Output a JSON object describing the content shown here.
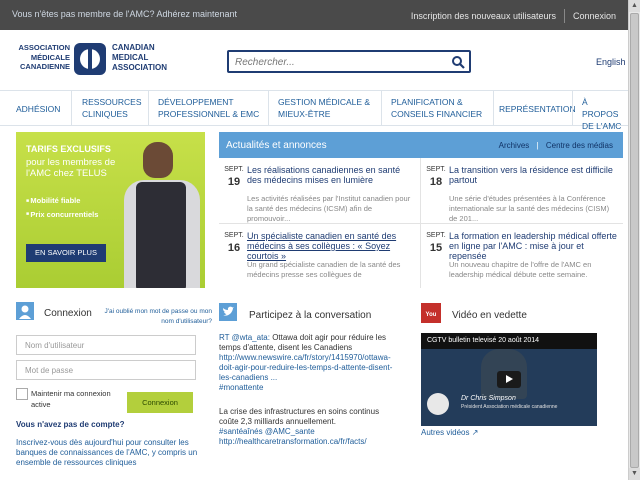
{
  "topbar": {
    "not_member": "Vous n'êtes pas membre de l'AMC? Adhérez maintenant",
    "new_users": "Inscription des nouveaux utilisateurs",
    "login": "Connexion"
  },
  "logo": {
    "fr_line1": "ASSOCIATION",
    "fr_line2": "MÉDICALE",
    "fr_line3": "CANADIENNE",
    "en_line1": "CANADIAN",
    "en_line2": "MEDICAL",
    "en_line3": "ASSOCIATION"
  },
  "search": {
    "placeholder": "Rechercher..."
  },
  "lang_switch": "English",
  "nav": [
    "ADHÉSION",
    "RESSOURCES CLINIQUES",
    "DÉVELOPPEMENT PROFESSIONNEL & EMC",
    "GESTION MÉDICALE & MIEUX-ÊTRE",
    "PLANIFICATION & CONSEILS FINANCIER",
    "REPRÉSENTATION",
    "À PROPOS DE L'AMC"
  ],
  "promo": {
    "title": "TARIFS EXCLUSIFS",
    "subtitle": "pour les membres de l'AMC chez TELUS",
    "bullets": [
      "Mobilité fiable",
      "Prix concurrentiels"
    ],
    "cta": "EN SAVOIR PLUS"
  },
  "news": {
    "title": "Actualités et annonces",
    "archives": "Archives",
    "media": "Centre des médias",
    "items": [
      {
        "month": "SEPT.",
        "day": "19",
        "headline": "Les réalisations canadiennes en santé des médecins mises en lumière",
        "summary": "Les activités réalisées par l'Institut canadien pour la santé des médecins (ICSM) afin de promouvoir..."
      },
      {
        "month": "SEPT.",
        "day": "18",
        "headline": "La transition vers la résidence est difficile partout",
        "summary": "Une série d'études présentées à la Conférence internationale sur la santé des médecins (CISM) de 201..."
      },
      {
        "month": "SEPT.",
        "day": "16",
        "headline": "Un spécialiste canadien en santé des médecins à ses collègues : « Soyez courtois »",
        "summary": "Un grand spécialiste canadien de la santé des médecins presse ses collègues de"
      },
      {
        "month": "SEPT.",
        "day": "15",
        "headline": "La formation en leadership médical offerte en ligne par l'AMC : mise à jour et repensée",
        "summary": "Un nouveau chapitre de l'offre de l'AMC en leadership médical débute cette semaine."
      }
    ]
  },
  "login": {
    "title": "Connexion",
    "forgot": "J'ai oublié mon mot de passe ou mon nom d'utilisateur?",
    "username_placeholder": "Nom d'utilisateur",
    "password_placeholder": "Mot de passe",
    "remember": "Maintenir ma connexion active",
    "button": "Connexion",
    "no_account": "Vous n'avez pas de compte?",
    "signup_text": "Inscrivez-vous dès aujourd'hui pour consulter les banques de connaissances de l'AMC, y compris un ensemble de ressources cliniques"
  },
  "twitter": {
    "title": "Participez à la conversation",
    "tweet1_handle": "RT @wta_ata:",
    "tweet1_text": " Ottawa doit agir pour réduire les temps d'attente, disent les Canadiens ",
    "tweet1_link": "http://www.newswire.ca/fr/story/1415970/ottawa-doit-agir-pour-reduire-les-temps-d-attente-disent-les-canadiens ...",
    "tweet1_tag": "#monattente",
    "tweet2_text": "La crise des infrastructures en soins continus coûte 2,3 milliards annuellement. ",
    "tweet2_tags": "#santéaînés @AMC_sante",
    "tweet2_link": "http://healthcaretransformation.ca/fr/facts/"
  },
  "video": {
    "title": "Vidéo en vedette",
    "bar_title": "CGTV bulletin televisé 20 août 2014",
    "speaker": "Dr Chris Simpson",
    "role": "Président Association médicale canadienne",
    "more": "Autres vidéos"
  },
  "colors": {
    "brand_navy": "#1f3c73",
    "news_blue": "#5d9fd6",
    "promo_green": "#aacd33",
    "topbar_gray": "#4a4a4a"
  }
}
